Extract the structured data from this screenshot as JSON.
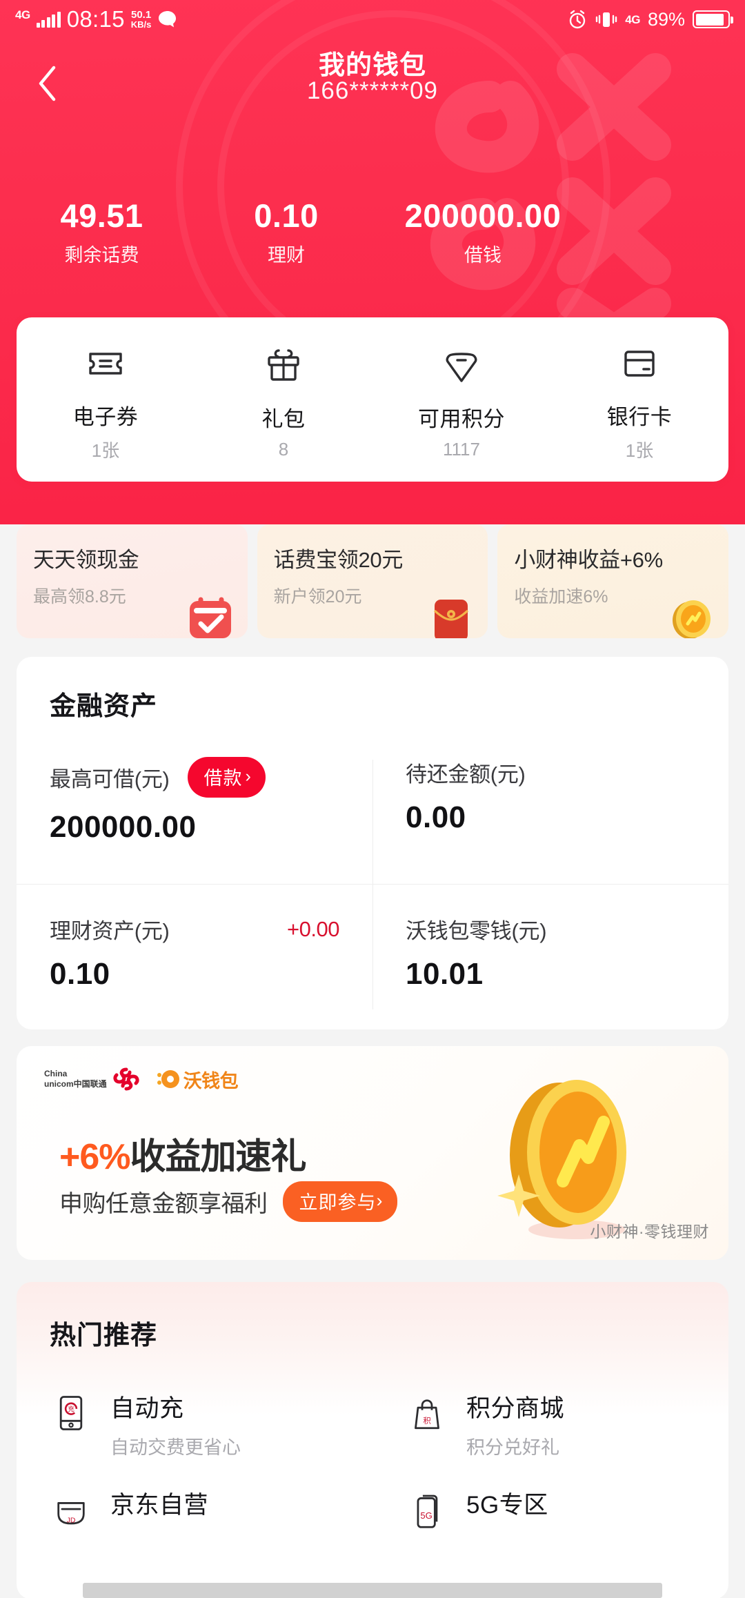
{
  "statusbar": {
    "network_label": "4G",
    "time": "08:15",
    "speed_value": "50.1",
    "speed_unit": "KB/s",
    "chat_icon": "chat-bubble-icon",
    "alarm_icon": "alarm-clock-icon",
    "vibrate_icon": "vibrate-icon",
    "network_right": "4G",
    "battery_percent": "89%"
  },
  "header": {
    "back_icon": "back-chevron-icon",
    "title": "我的钱包",
    "phone": "166******09"
  },
  "stats": [
    {
      "value": "49.51",
      "label": "剩余话费"
    },
    {
      "value": "0.10",
      "label": "理财"
    },
    {
      "value": "200000.00",
      "label": "借钱"
    }
  ],
  "quick_actions": [
    {
      "icon": "ticket-icon",
      "name": "电子券",
      "sub": "1张"
    },
    {
      "icon": "gift-box-icon",
      "name": "礼包",
      "sub": "8"
    },
    {
      "icon": "points-tag-icon",
      "name": "可用积分",
      "sub": "1117"
    },
    {
      "icon": "bank-card-icon",
      "name": "银行卡",
      "sub": "1张"
    }
  ],
  "promos": [
    {
      "title": "天天领现金",
      "sub": "最高领8.8元",
      "icon": "calendar-check-icon"
    },
    {
      "title": "话费宝领20元",
      "sub": "新户领20元",
      "icon": "red-envelope-icon"
    },
    {
      "title": "小财神收益+6%",
      "sub": "收益加速6%",
      "icon": "gold-coin-icon"
    }
  ],
  "financial": {
    "title": "金融资产",
    "loan_button": "借款",
    "loan_button_chevron": "›",
    "cells": [
      {
        "label": "最高可借(元)",
        "value": "200000.00"
      },
      {
        "label": "待还金额(元)",
        "value": "0.00"
      },
      {
        "label": "理财资产(元)",
        "value": "0.10",
        "delta": "+0.00"
      },
      {
        "label": "沃钱包零钱(元)",
        "value": "10.01"
      }
    ]
  },
  "ad": {
    "brand_line1": "China",
    "brand_line2": "unicom中国联通",
    "wallet_brand": "沃钱包",
    "headline_accent": "+6%",
    "headline_rest": "收益加速礼",
    "subtitle": "申购任意金额享福利",
    "cta": "立即参与",
    "cta_chevron": "›",
    "watermark": "小财神·零钱理财",
    "coin_icon": "gold-coin-icon"
  },
  "hot": {
    "title": "热门推荐",
    "items": [
      {
        "icon": "auto-recharge-phone-icon",
        "name": "自动充",
        "desc": "自动交费更省心"
      },
      {
        "icon": "points-mall-bag-icon",
        "name": "积分商城",
        "desc": "积分兑好礼"
      },
      {
        "icon": "jd-store-icon",
        "name": "京东自营",
        "desc": ""
      },
      {
        "icon": "5g-zone-icon",
        "name": "5G专区",
        "desc": ""
      }
    ]
  },
  "colors": {
    "brand_red": "#fb2a4b",
    "accent_red": "#f5072e",
    "orange": "#fa6023",
    "coin_gold": "#fbb01b"
  }
}
